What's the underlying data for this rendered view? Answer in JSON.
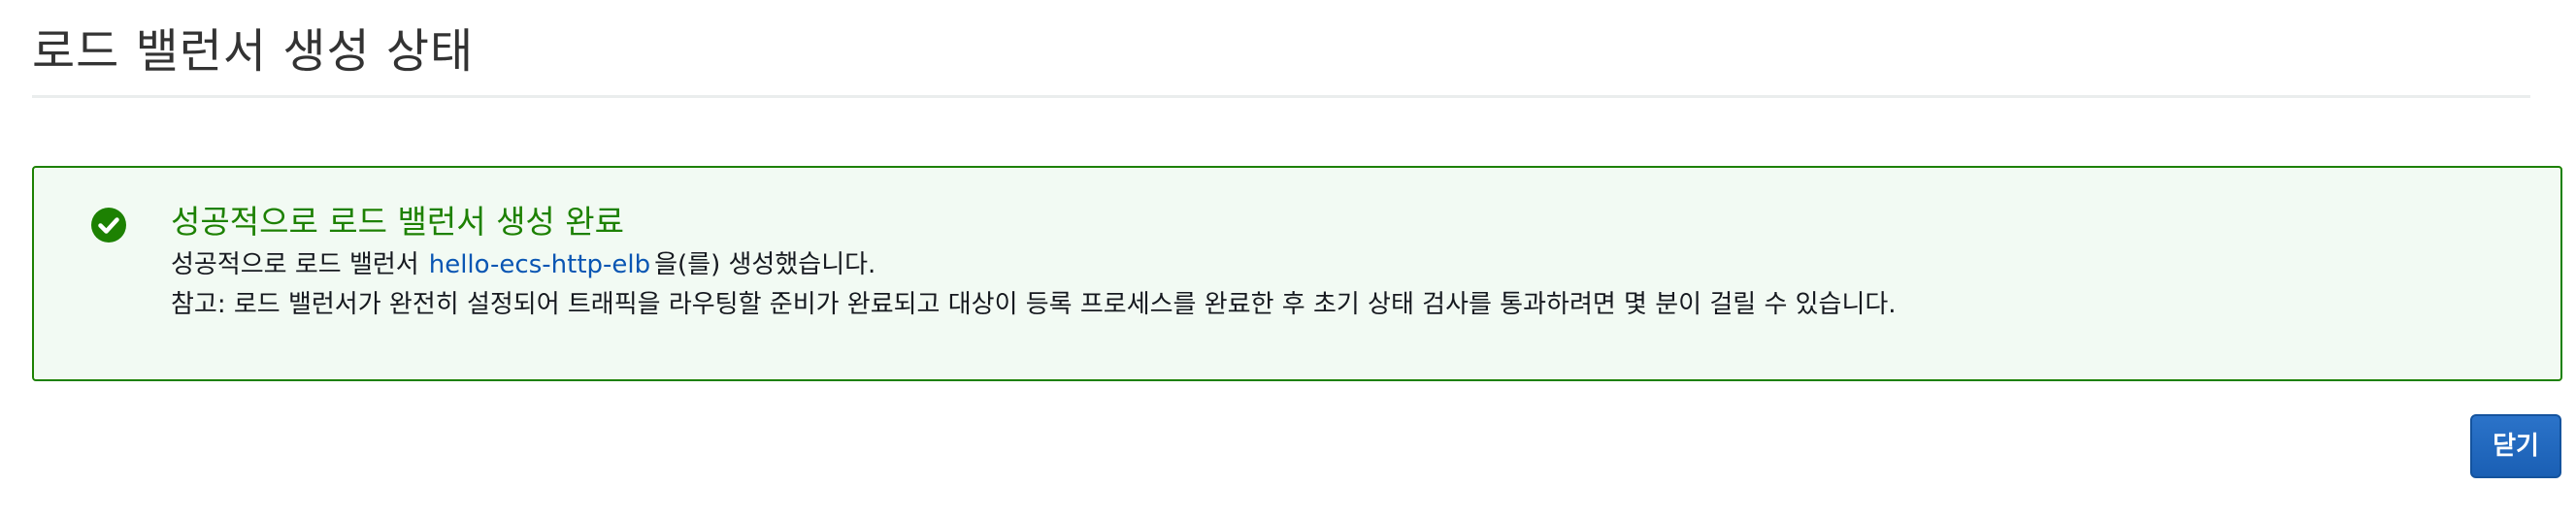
{
  "page": {
    "title": "로드 밸런서 생성 상태"
  },
  "status_panel": {
    "icon": "check-circle-icon",
    "heading": "성공적으로 로드 밸런서 생성 완료",
    "message_prefix": "성공적으로 로드 밸런서",
    "load_balancer_name": "hello-ecs-http-elb",
    "message_suffix": "을(를) 생성했습니다.",
    "note": "참고: 로드 밸런서가 완전히 설정되어 트래픽을 라우팅할 준비가 완료되고 대상이 등록 프로세스를 완료한 후 초기 상태 검사를 통과하려면 몇 분이 걸릴 수 있습니다."
  },
  "actions": {
    "close_label": "닫기"
  },
  "colors": {
    "success_green": "#1d8102",
    "success_background": "#f2faf3",
    "link_blue": "#0a56b3",
    "primary_button": "#1a5fb4"
  }
}
